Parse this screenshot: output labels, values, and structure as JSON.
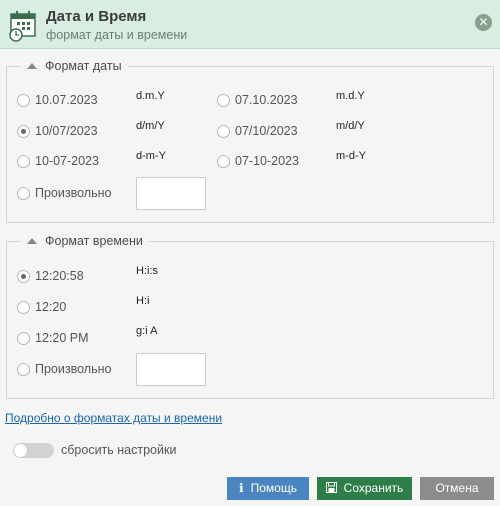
{
  "header": {
    "title": "Дата и Время",
    "subtitle": "формат даты и времени",
    "icon": "calendar-clock-icon",
    "close_icon": "close-icon"
  },
  "date_format": {
    "legend": "Формат даты",
    "options": [
      {
        "label": "10.07.2023",
        "code": "d.m.Y",
        "checked": false
      },
      {
        "label": "07.10.2023",
        "code": "m.d.Y",
        "checked": false
      },
      {
        "label": "10/07/2023",
        "code": "d/m/Y",
        "checked": true
      },
      {
        "label": "07/10/2023",
        "code": "m/d/Y",
        "checked": false
      },
      {
        "label": "10-07-2023",
        "code": "d-m-Y",
        "checked": false
      },
      {
        "label": "07-10-2023",
        "code": "m-d-Y",
        "checked": false
      }
    ],
    "custom_label": "Произвольно",
    "custom_value": ""
  },
  "time_format": {
    "legend": "Формат времени",
    "options": [
      {
        "label": "12:20:58",
        "code": "H:i:s",
        "checked": true
      },
      {
        "label": "12:20",
        "code": "H:i",
        "checked": false
      },
      {
        "label": "12:20 PM",
        "code": "g:i A",
        "checked": false
      }
    ],
    "custom_label": "Произвольно",
    "custom_value": ""
  },
  "help_link": "Подробно о форматах даты и времени",
  "reset": {
    "label": "сбросить настройки",
    "enabled": false
  },
  "buttons": {
    "help": "Помощь",
    "save": "Сохранить",
    "cancel": "Отмена"
  },
  "colors": {
    "header_bg": "#d9ede3",
    "help_button": "#4a85c1",
    "save_button": "#2e7e4a",
    "cancel_button": "#8c8c8c",
    "link": "#1a66b3"
  }
}
